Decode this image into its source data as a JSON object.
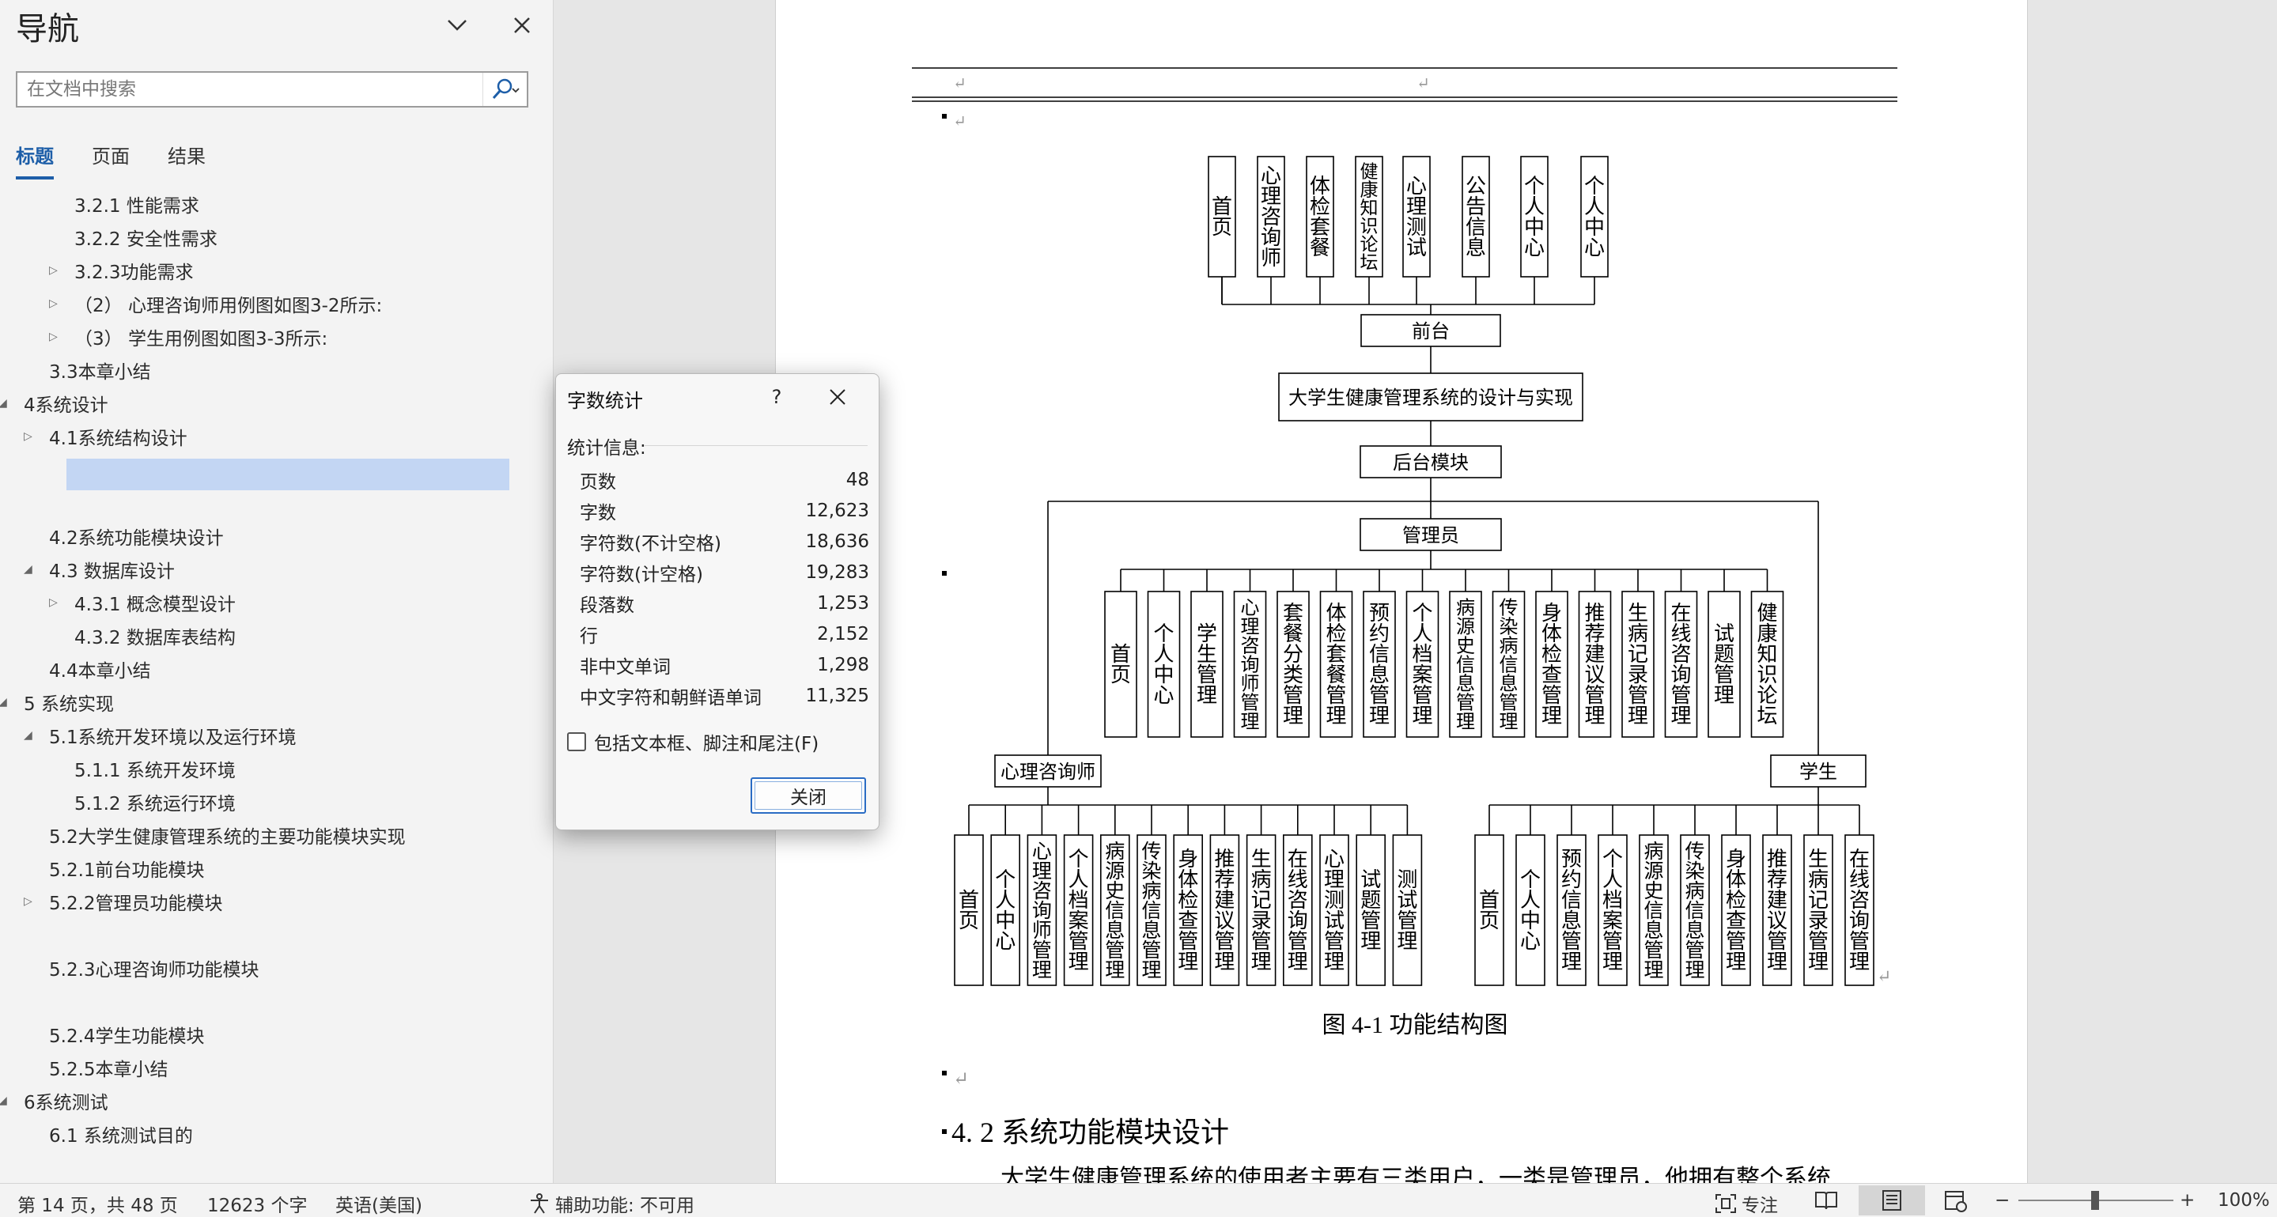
{
  "nav_pane": {
    "title": "导航",
    "search_placeholder": "在文档中搜索",
    "tabs": [
      "标题",
      "页面",
      "结果"
    ],
    "items": [
      {
        "label": "3.2.1 性能需求",
        "level": 3,
        "toggle": "none"
      },
      {
        "label": "3.2.2 安全性需求",
        "level": 3,
        "toggle": "none"
      },
      {
        "label": "3.2.3功能需求",
        "level": 3,
        "toggle": "collapsed"
      },
      {
        "label": "（2） 心理咨询师用例图如图3-2所示:",
        "level": 3,
        "toggle": "collapsed"
      },
      {
        "label": "（3） 学生用例图如图3-3所示:",
        "level": 3,
        "toggle": "collapsed"
      },
      {
        "label": "3.3本章小结",
        "level": 2,
        "toggle": "none"
      },
      {
        "label": "4系统设计",
        "level": 1,
        "toggle": "expanded"
      },
      {
        "label": "4.1系统结构设计",
        "level": 2,
        "toggle": "collapsed"
      },
      {
        "label": "",
        "level": 2,
        "toggle": "none",
        "selected": true
      },
      {
        "label": "",
        "level": 2,
        "toggle": "none"
      },
      {
        "label": "4.2系统功能模块设计",
        "level": 2,
        "toggle": "none"
      },
      {
        "label": "4.3 数据库设计",
        "level": 2,
        "toggle": "expanded"
      },
      {
        "label": "4.3.1 概念模型设计",
        "level": 3,
        "toggle": "collapsed"
      },
      {
        "label": "4.3.2 数据库表结构",
        "level": 3,
        "toggle": "none"
      },
      {
        "label": "4.4本章小结",
        "level": 2,
        "toggle": "none"
      },
      {
        "label": "5 系统实现",
        "level": 1,
        "toggle": "expanded"
      },
      {
        "label": "5.1系统开发环境以及运行环境",
        "level": 2,
        "toggle": "expanded"
      },
      {
        "label": "5.1.1 系统开发环境",
        "level": 3,
        "toggle": "none"
      },
      {
        "label": "5.1.2 系统运行环境",
        "level": 3,
        "toggle": "none"
      },
      {
        "label": "5.2大学生健康管理系统的主要功能模块实现",
        "level": 2,
        "toggle": "none"
      },
      {
        "label": "5.2.1前台功能模块",
        "level": 2,
        "toggle": "none"
      },
      {
        "label": "5.2.2管理员功能模块",
        "level": 2,
        "toggle": "collapsed"
      },
      {
        "label": "",
        "level": 2,
        "toggle": "none"
      },
      {
        "label": "5.2.3心理咨询师功能模块",
        "level": 2,
        "toggle": "none"
      },
      {
        "label": "",
        "level": 2,
        "toggle": "none"
      },
      {
        "label": "5.2.4学生功能模块",
        "level": 2,
        "toggle": "none"
      },
      {
        "label": "5.2.5本章小结",
        "level": 2,
        "toggle": "none"
      },
      {
        "label": "6系统测试",
        "level": 1,
        "toggle": "expanded"
      },
      {
        "label": "6.1 系统测试目的",
        "level": 2,
        "toggle": "none"
      }
    ]
  },
  "dialog": {
    "title": "字数统计",
    "help": "?",
    "section_label": "统计信息:",
    "stats": [
      {
        "label": "页数",
        "value": "48"
      },
      {
        "label": "字数",
        "value": "12,623"
      },
      {
        "label": "字符数(不计空格)",
        "value": "18,636"
      },
      {
        "label": "字符数(计空格)",
        "value": "19,283"
      },
      {
        "label": "段落数",
        "value": "1,253"
      },
      {
        "label": "行",
        "value": "2,152"
      },
      {
        "label": "非中文单词",
        "value": "1,298"
      },
      {
        "label": "中文字符和朝鲜语单词",
        "value": "11,325"
      }
    ],
    "checkbox_label": "包括文本框、脚注和尾注(F)",
    "checkbox_checked": false,
    "close_label": "关闭"
  },
  "document": {
    "diagram": {
      "front_items": [
        "首页",
        "心理咨询师",
        "体检套餐",
        "健康知识论坛",
        "心理测试",
        "公告信息",
        "个人中心",
        "个人中心"
      ],
      "front_label": "前台",
      "system_title": "大学生健康管理系统的设计与实现",
      "backend_label": "后台模块",
      "admin_label": "管理员",
      "admin_items": [
        "首页",
        "个人中心",
        "学生管理",
        "心理咨询师管理",
        "套餐分类管理",
        "体检套餐管理",
        "预约信息管理",
        "个人档案管理",
        "病源史信息管理",
        "传染病信息管理",
        "身体检查管理",
        "推荐建议管理",
        "生病记录管理",
        "在线咨询管理",
        "试题管理",
        "健康知识论坛"
      ],
      "counselor_label": "心理咨询师",
      "counselor_items": [
        "首页",
        "个人中心",
        "心理咨询师管理",
        "个人档案管理",
        "病源史信息管理",
        "传染病信息管理",
        "身体检查管理",
        "推荐建议管理",
        "生病记录管理",
        "在线咨询管理",
        "心理测试管理",
        "试题管理",
        "测试管理"
      ],
      "student_label": "学生",
      "student_items": [
        "首页",
        "个人中心",
        "预约信息管理",
        "个人档案管理",
        "病源史信息管理",
        "传染病信息管理",
        "身体检查管理",
        "推荐建议管理",
        "生病记录管理",
        "在线咨询管理"
      ]
    },
    "caption": "图 4-1 功能结构图",
    "heading": "4. 2 系统功能模块设计",
    "body_partial": "大学生健康管理系统的使用者主要有三类用户，一类是管理员，他拥有整个系统"
  },
  "status_bar": {
    "page_info": "第 14 页，共 48 页",
    "word_count": "12623 个字",
    "language": "英语(美国)",
    "accessibility": "辅助功能: 不可用",
    "focus": "专注",
    "zoom": "100%"
  }
}
